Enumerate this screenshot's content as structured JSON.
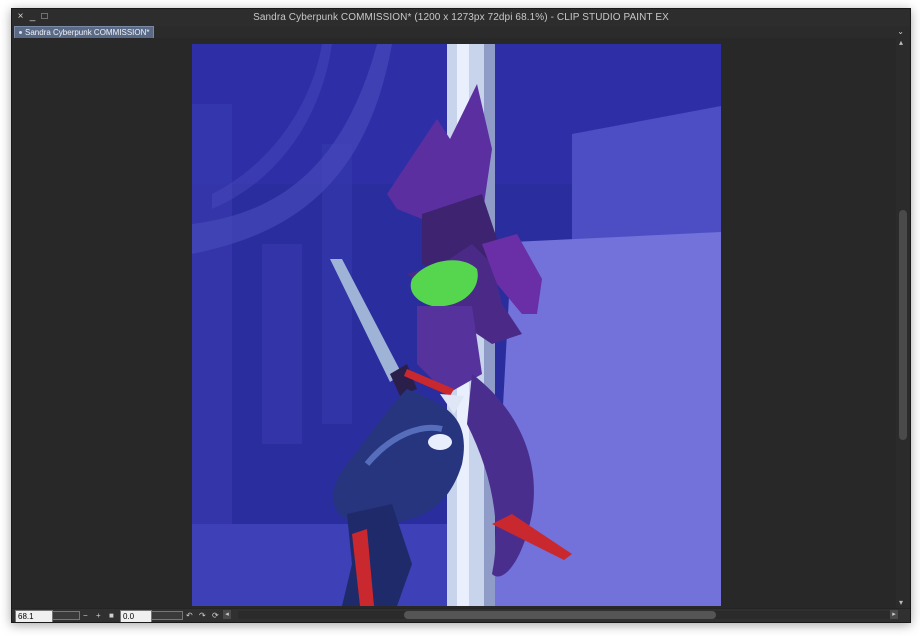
{
  "window": {
    "title": "Sandra Cyberpunk COMMISSION* (1200 x 1273px 72dpi 68.1%)  - CLIP STUDIO PAINT EX",
    "controls": {
      "close": "×",
      "minimize": "_",
      "maximize": "□"
    }
  },
  "tabs": [
    {
      "label": "Sandra Cyberpunk COMMISSION*",
      "active": true
    }
  ],
  "tab_menu": "⌄",
  "canvas": {
    "background": "#282828",
    "artwork_colors": {
      "sky": "#2a2d9e",
      "wall": "#6f6fd8",
      "pole": "#c9d4ec",
      "accent_green": "#56d64e",
      "accent_red": "#c8282e"
    }
  },
  "statusbar": {
    "zoom_value": "68.1",
    "zoom_out": "−",
    "zoom_in": "+",
    "fit": "■",
    "rotation_value": "0.0",
    "rotate_left": "↶",
    "rotate_right": "↷",
    "reset_rotation": "⟳",
    "scroll_left": "◂",
    "scroll_right": "▸"
  },
  "scrollbar": {
    "up": "▴",
    "down": "▾"
  }
}
